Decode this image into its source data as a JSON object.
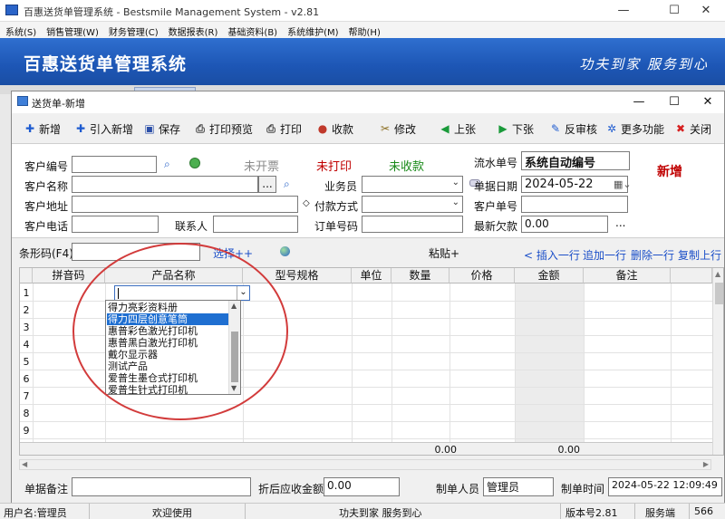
{
  "app": {
    "window_title": "百惠送货单管理系统 - Bestsmile Management System - v2.81",
    "system_name": "百惠送货单管理系统",
    "motto": "功夫到家 服务到心"
  },
  "menu": [
    "系统(S)",
    "销售管理(W)",
    "财务管理(C)",
    "数据报表(R)",
    "基础资料(B)",
    "系统维护(M)",
    "帮助(H)"
  ],
  "dialog": {
    "title": "送货单-新增",
    "toolbar": [
      {
        "label": "新增",
        "icon": "plus-icon",
        "color": "#1e5bd0",
        "glyph": "✚"
      },
      {
        "label": "引入新增",
        "icon": "import-add-icon",
        "color": "#1e5bd0",
        "glyph": "✚"
      },
      {
        "label": "保存",
        "icon": "save-icon",
        "color": "#2b4fa8",
        "glyph": "▣"
      },
      {
        "label": "打印预览",
        "icon": "print-preview-icon",
        "color": "#444444",
        "glyph": "⎙"
      },
      {
        "label": "打印",
        "icon": "print-icon",
        "color": "#444444",
        "glyph": "⎙"
      },
      {
        "label": "收款",
        "icon": "collect-icon",
        "color": "#c0392b",
        "glyph": "●"
      },
      {
        "label": "修改",
        "icon": "edit-icon",
        "color": "#8a6d1f",
        "glyph": "✂"
      },
      {
        "label": "上张",
        "icon": "prev-icon",
        "color": "#1a9a3a",
        "glyph": "◀"
      },
      {
        "label": "下张",
        "icon": "next-icon",
        "color": "#1a9a3a",
        "glyph": "▶"
      },
      {
        "label": "反审核",
        "icon": "unaudit-icon",
        "color": "#1e5bd0",
        "glyph": "✎"
      },
      {
        "label": "更多功能",
        "icon": "more-functions-icon",
        "color": "#1e5bd0",
        "glyph": "✲"
      },
      {
        "label": "关闭",
        "icon": "close-icon",
        "color": "#d62020",
        "glyph": "✖"
      }
    ],
    "form": {
      "customer_no_label": "客户编号",
      "customer_name_label": "客户名称",
      "customer_address_label": "客户地址",
      "customer_phone_label": "客户电话",
      "contact_label": "联系人",
      "status_invoice": "未开票",
      "status_print": "未打印",
      "status_payment": "未收款",
      "salesperson_label": "业务员",
      "payment_method_label": "付款方式",
      "order_no_label": "订单号码",
      "serial_no_label": "流水单号",
      "serial_no_value": "系统自动编号",
      "doc_date_label": "单据日期",
      "doc_date_value": "2024-05-22",
      "customer_doc_no_label": "客户单号",
      "latest_debt_label": "最新欠款",
      "latest_debt_value": "0.00",
      "mode_badge": "新增",
      "browse_button": "...",
      "more_button": "...",
      "diamond": "◇"
    },
    "barcode": {
      "label": "条形码(F4)",
      "select_link": "选择++",
      "paste_label": "粘贴+",
      "insert_row": "< 插入一行",
      "append_row": "追加一行",
      "delete_row": "删除一行",
      "copy_row": "复制上行"
    },
    "grid": {
      "columns": [
        "拼音码",
        "产品名称",
        "型号规格",
        "单位",
        "数量",
        "价格",
        "金额",
        "备注"
      ],
      "rows": [
        "1",
        "2",
        "3",
        "4",
        "5",
        "6",
        "7",
        "8",
        "9"
      ],
      "qty_total": "0.00",
      "amount_total": "0.00"
    },
    "product_dropdown": {
      "items": [
        "得力亮彩资料册",
        "得力四层创意笔筒",
        "惠普彩色激光打印机",
        "惠普黑白激光打印机",
        "戴尔显示器",
        "测试产品",
        "爱普生墨仓式打印机",
        "爱普生针式打印机"
      ],
      "selected_index": 1
    },
    "footer": {
      "remark_label": "单据备注",
      "discount_label": "折后应收金额",
      "discount_value": "0.00",
      "creator_label": "制单人员",
      "creator_value": "管理员",
      "create_time_label": "制单时间",
      "create_time_value": "2024-05-22 12:09:49"
    }
  },
  "statusbar": {
    "user": "用户名:管理员",
    "welcome": "欢迎使用",
    "motto": "功夫到家 服务到心",
    "version": "版本号2.81",
    "service": "服务端",
    "code": "566"
  },
  "colors": {
    "banner": "#1d56b5",
    "selection": "#1f6fd1",
    "status_red": "#c00000",
    "status_green": "#1a8a1a",
    "link": "#1a4ec8",
    "annotation_circle": "#d23b3b"
  }
}
